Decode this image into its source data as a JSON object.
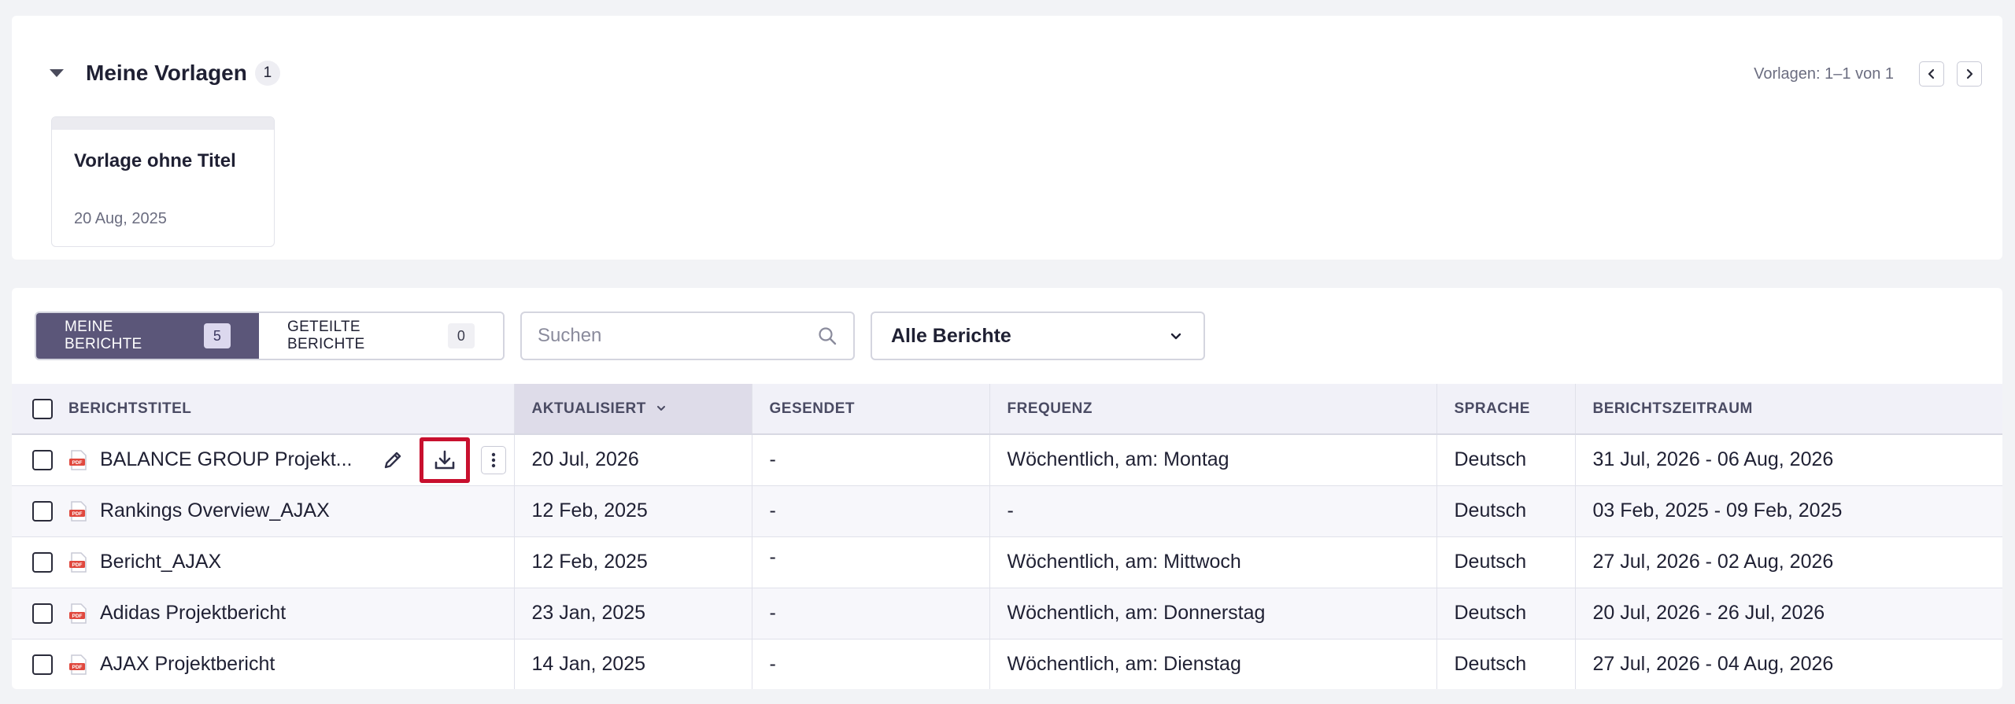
{
  "templates": {
    "title": "Meine Vorlagen",
    "count": "1",
    "pager_text": "Vorlagen: 1–1 von 1",
    "items": [
      {
        "name": "Vorlage ohne Titel",
        "date": "20 Aug, 2025"
      }
    ]
  },
  "reports": {
    "tabs": [
      {
        "label": "MEINE BERICHTE",
        "count": "5",
        "active": true
      },
      {
        "label": "GETEILTE BERICHTE",
        "count": "0",
        "active": false
      }
    ],
    "search_placeholder": "Suchen",
    "filter_value": "Alle Berichte",
    "columns": {
      "title": "BERICHTSTITEL",
      "updated": "AKTUALISIERT",
      "sent": "GESENDET",
      "frequency": "FREQUENZ",
      "language": "SPRACHE",
      "period": "BERICHTSZEITRAUM"
    },
    "rows": [
      {
        "title": "BALANCE GROUP Projekt...",
        "updated": "20 Jul, 2026",
        "sent": "-",
        "frequency": "Wöchentlich, am: Montag",
        "language": "Deutsch",
        "period": "31 Jul, 2026 - 06 Aug, 2026"
      },
      {
        "title": "Rankings Overview_AJAX",
        "updated": "12 Feb, 2025",
        "sent": "-",
        "frequency": "-",
        "language": "Deutsch",
        "period": "03 Feb, 2025 - 09 Feb, 2025"
      },
      {
        "title": "Bericht_AJAX",
        "updated": "12 Feb, 2025",
        "sent": "-",
        "frequency": "Wöchentlich, am: Mittwoch",
        "language": "Deutsch",
        "period": "27 Jul, 2026 - 02 Aug, 2026"
      },
      {
        "title": "Adidas Projektbericht",
        "updated": "23 Jan, 2025",
        "sent": "-",
        "frequency": "Wöchentlich, am: Donnerstag",
        "language": "Deutsch",
        "period": "20 Jul, 2026 - 26 Jul, 2026"
      },
      {
        "title": "AJAX Projektbericht",
        "updated": "14 Jan, 2025",
        "sent": "-",
        "frequency": "Wöchentlich, am: Dienstag",
        "language": "Deutsch",
        "period": "27 Jul, 2026 - 04 Aug, 2026"
      }
    ]
  },
  "colors": {
    "accent": "#5b5679",
    "highlight_border": "#c8102e",
    "pdf_icon": "#e0483e"
  },
  "icons": [
    "caret-down-icon",
    "chevron-left-icon",
    "chevron-right-icon",
    "search-icon",
    "chevron-down-icon",
    "pdf-file-icon",
    "pencil-icon",
    "download-icon",
    "more-vertical-icon",
    "sort-desc-icon"
  ]
}
